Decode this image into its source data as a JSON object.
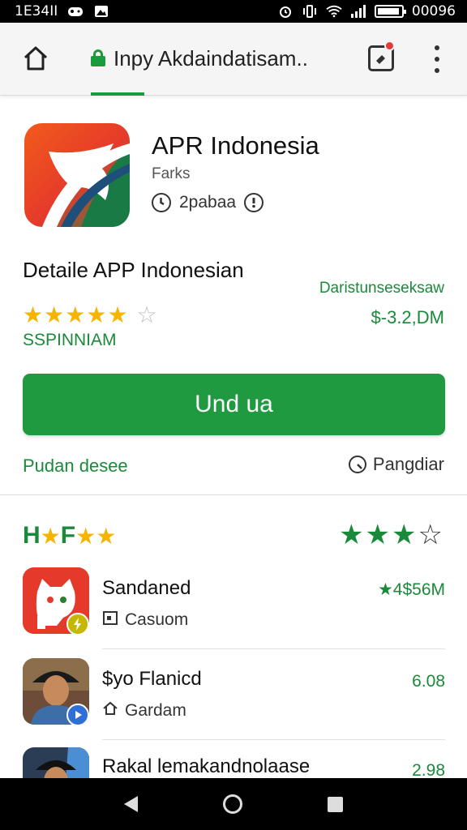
{
  "status_bar": {
    "time": "1E34II",
    "right_text": "00096"
  },
  "toolbar": {
    "url": "Inpy Akdaindatisam.."
  },
  "app": {
    "title": "APR Indonesia",
    "subtitle": "Farks",
    "meta": "2pabaa"
  },
  "details": {
    "title": "Detaile APP Indonesian",
    "right_label": "Daristunseseksaw",
    "price": "$-3.2,DM",
    "sub": "SSPINNIAM",
    "rating": 5,
    "rating_max": 6
  },
  "install_label": "Und ua",
  "links": {
    "left": "Pudan desee",
    "right": "Pangdiar"
  },
  "section": {
    "title": "H",
    "stars_filled": 3,
    "colors": {
      "accent": "#1f9a41",
      "star": "#f5b400"
    }
  },
  "list": [
    {
      "title": "Sandaned",
      "sub": "Casuom",
      "value": "★4$56M"
    },
    {
      "title": "$yo Flanicd",
      "sub": "Gardam",
      "value": "6.08"
    },
    {
      "title": "Rakal lemakandnolaase",
      "sub": "",
      "value": "2.98"
    }
  ]
}
